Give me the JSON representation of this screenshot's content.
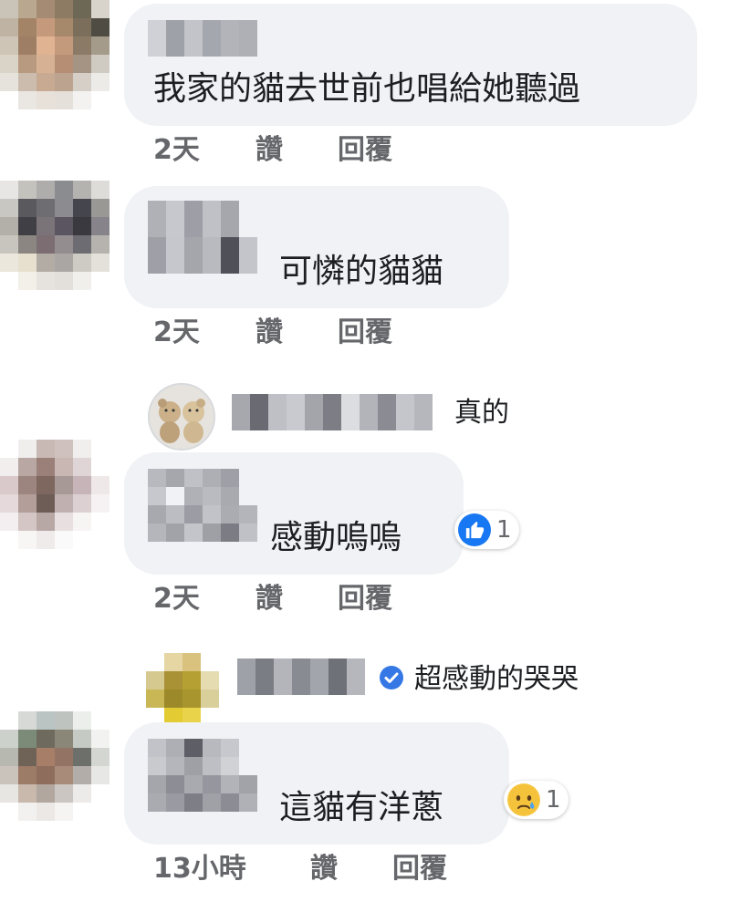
{
  "colors": {
    "bubble_bg": "#f0f2f5",
    "meta_text": "#65676b",
    "like_blue": "#1877f2",
    "verified_blue": "#3578e5"
  },
  "comments": [
    {
      "text": "我家的貓去世前也唱給她聽過",
      "time": "2天",
      "like_label": "讚",
      "reply_label": "回覆"
    },
    {
      "text": "可憐的貓貓",
      "time": "2天",
      "like_label": "讚",
      "reply_label": "回覆",
      "reply": {
        "text": "真的"
      }
    },
    {
      "text": "感動嗚嗚",
      "reaction": {
        "icon": "thumbs-up-icon",
        "count": "1"
      },
      "time": "2天",
      "like_label": "讚",
      "reply_label": "回覆",
      "reply": {
        "text": "超感動的哭哭",
        "verified_icon": "verified-check-icon"
      }
    },
    {
      "text": "這貓有洋蔥",
      "reaction": {
        "icon": "sad-face-icon",
        "count": "1"
      },
      "time": "13小時",
      "like_label": "讚",
      "reply_label": "回覆"
    }
  ]
}
